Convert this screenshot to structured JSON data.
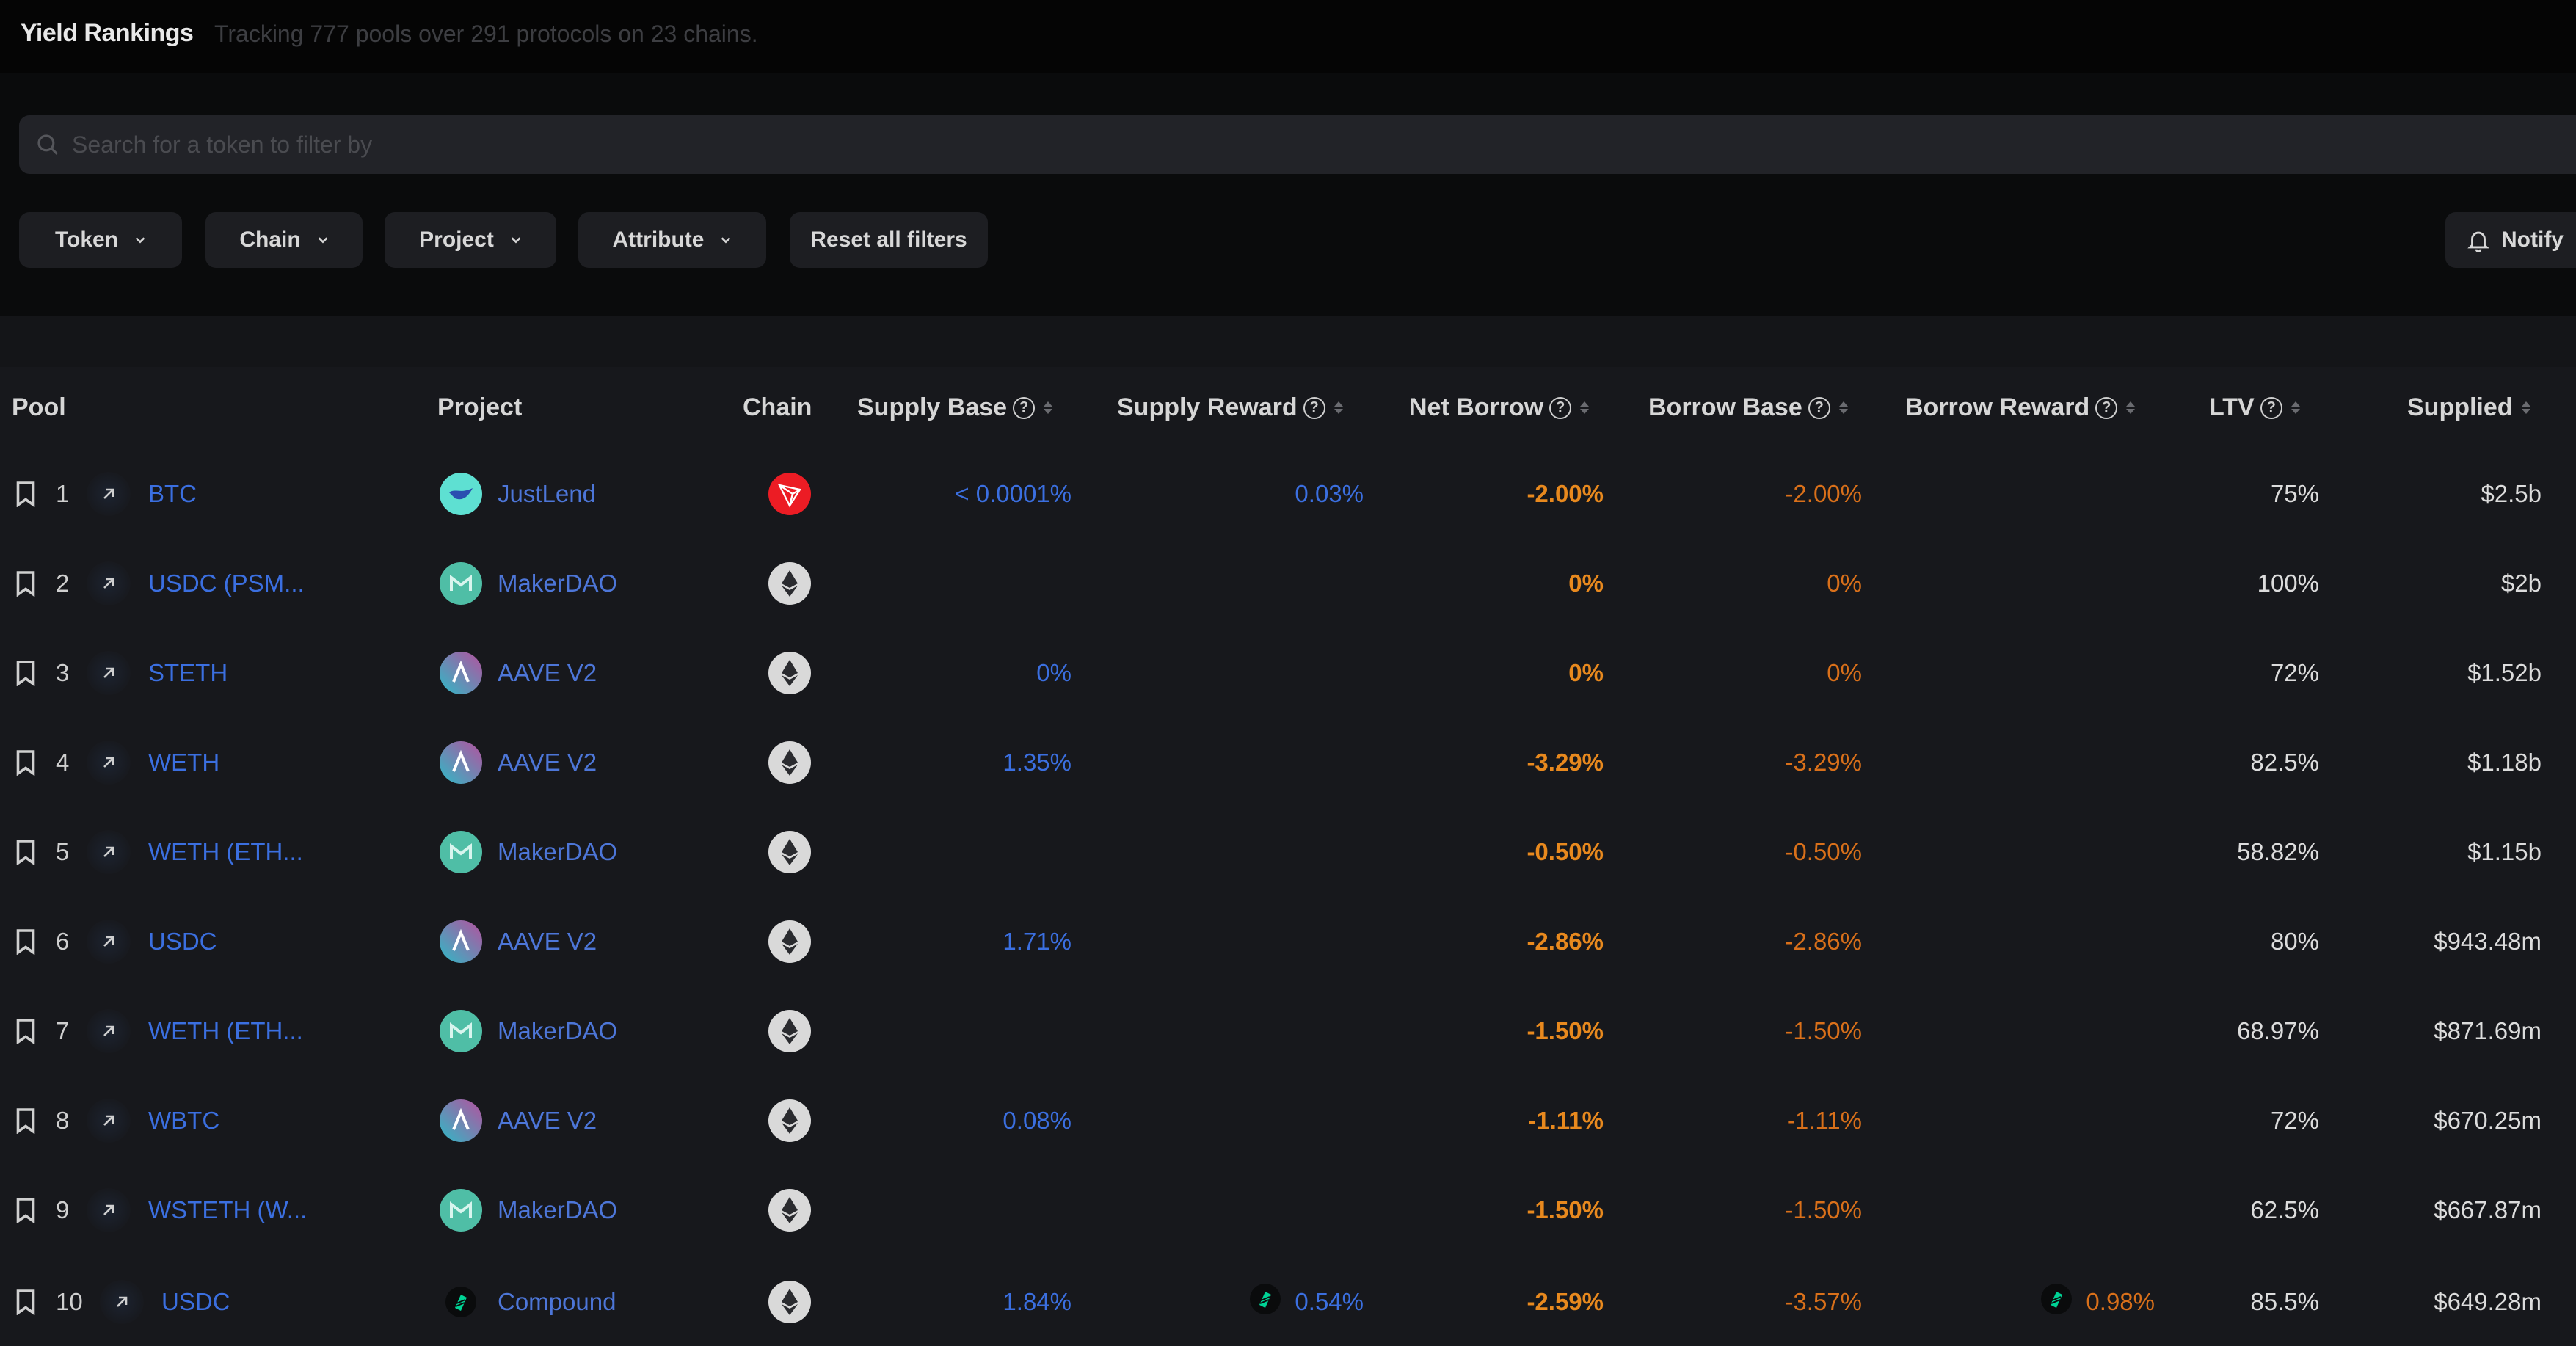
{
  "header": {
    "title": "Yield Rankings",
    "subtitle": "Tracking 777 pools over 291 protocols on 23 chains."
  },
  "search": {
    "placeholder": "Search for a token to filter by",
    "value": ""
  },
  "filters": {
    "token": "Token",
    "chain": "Chain",
    "project": "Project",
    "attribute": "Attribute",
    "reset": "Reset all filters",
    "notify": "Notify"
  },
  "colors": {
    "blue_value": "#3b6fe0",
    "orange_value": "#e8891e",
    "background": "#17181c",
    "tron_red": "#ec1c24",
    "maker_teal": "#4fbea6",
    "compound_green": "#00d395"
  },
  "table": {
    "columns": {
      "pool": "Pool",
      "project": "Project",
      "chain": "Chain",
      "supply_base": "Supply Base",
      "supply_reward": "Supply Reward",
      "net_borrow": "Net Borrow",
      "borrow_base": "Borrow Base",
      "borrow_reward": "Borrow Reward",
      "ltv": "LTV",
      "supplied": "Supplied"
    },
    "rows": [
      {
        "rank": "1",
        "pool": "BTC",
        "project": "JustLend",
        "project_icon": "justlend-icon",
        "chain_icon": "tron-icon",
        "supply_base": "< 0.0001%",
        "supply_reward": "0.03%",
        "supply_reward_icon": "",
        "net_borrow": "-2.00%",
        "borrow_base": "-2.00%",
        "borrow_reward": "",
        "borrow_reward_icon": "",
        "ltv": "75%",
        "supplied": "$2.5b"
      },
      {
        "rank": "2",
        "pool": "USDC (PSM...",
        "project": "MakerDAO",
        "project_icon": "makerdao-icon",
        "chain_icon": "ethereum-icon",
        "supply_base": "",
        "supply_reward": "",
        "supply_reward_icon": "",
        "net_borrow": "0%",
        "borrow_base": "0%",
        "borrow_reward": "",
        "borrow_reward_icon": "",
        "ltv": "100%",
        "supplied": "$2b"
      },
      {
        "rank": "3",
        "pool": "STETH",
        "project": "AAVE V2",
        "project_icon": "aave-icon",
        "chain_icon": "ethereum-icon",
        "supply_base": "0%",
        "supply_reward": "",
        "supply_reward_icon": "",
        "net_borrow": "0%",
        "borrow_base": "0%",
        "borrow_reward": "",
        "borrow_reward_icon": "",
        "ltv": "72%",
        "supplied": "$1.52b"
      },
      {
        "rank": "4",
        "pool": "WETH",
        "project": "AAVE V2",
        "project_icon": "aave-icon",
        "chain_icon": "ethereum-icon",
        "supply_base": "1.35%",
        "supply_reward": "",
        "supply_reward_icon": "",
        "net_borrow": "-3.29%",
        "borrow_base": "-3.29%",
        "borrow_reward": "",
        "borrow_reward_icon": "",
        "ltv": "82.5%",
        "supplied": "$1.18b"
      },
      {
        "rank": "5",
        "pool": "WETH (ETH...",
        "project": "MakerDAO",
        "project_icon": "makerdao-icon",
        "chain_icon": "ethereum-icon",
        "supply_base": "",
        "supply_reward": "",
        "supply_reward_icon": "",
        "net_borrow": "-0.50%",
        "borrow_base": "-0.50%",
        "borrow_reward": "",
        "borrow_reward_icon": "",
        "ltv": "58.82%",
        "supplied": "$1.15b"
      },
      {
        "rank": "6",
        "pool": "USDC",
        "project": "AAVE V2",
        "project_icon": "aave-icon",
        "chain_icon": "ethereum-icon",
        "supply_base": "1.71%",
        "supply_reward": "",
        "supply_reward_icon": "",
        "net_borrow": "-2.86%",
        "borrow_base": "-2.86%",
        "borrow_reward": "",
        "borrow_reward_icon": "",
        "ltv": "80%",
        "supplied": "$943.48m"
      },
      {
        "rank": "7",
        "pool": "WETH (ETH...",
        "project": "MakerDAO",
        "project_icon": "makerdao-icon",
        "chain_icon": "ethereum-icon",
        "supply_base": "",
        "supply_reward": "",
        "supply_reward_icon": "",
        "net_borrow": "-1.50%",
        "borrow_base": "-1.50%",
        "borrow_reward": "",
        "borrow_reward_icon": "",
        "ltv": "68.97%",
        "supplied": "$871.69m"
      },
      {
        "rank": "8",
        "pool": "WBTC",
        "project": "AAVE V2",
        "project_icon": "aave-icon",
        "chain_icon": "ethereum-icon",
        "supply_base": "0.08%",
        "supply_reward": "",
        "supply_reward_icon": "",
        "net_borrow": "-1.11%",
        "borrow_base": "-1.11%",
        "borrow_reward": "",
        "borrow_reward_icon": "",
        "ltv": "72%",
        "supplied": "$670.25m"
      },
      {
        "rank": "9",
        "pool": "WSTETH (W...",
        "project": "MakerDAO",
        "project_icon": "makerdao-icon",
        "chain_icon": "ethereum-icon",
        "supply_base": "",
        "supply_reward": "",
        "supply_reward_icon": "",
        "net_borrow": "-1.50%",
        "borrow_base": "-1.50%",
        "borrow_reward": "",
        "borrow_reward_icon": "",
        "ltv": "62.5%",
        "supplied": "$667.87m"
      },
      {
        "rank": "10",
        "pool": "USDC",
        "project": "Compound",
        "project_icon": "compound-icon",
        "chain_icon": "ethereum-icon",
        "supply_base": "1.84%",
        "supply_reward": "0.54%",
        "supply_reward_icon": "compound-icon",
        "net_borrow": "-2.59%",
        "borrow_base": "-3.57%",
        "borrow_reward": "0.98%",
        "borrow_reward_icon": "compound-icon",
        "ltv": "85.5%",
        "supplied": "$649.28m"
      }
    ]
  }
}
